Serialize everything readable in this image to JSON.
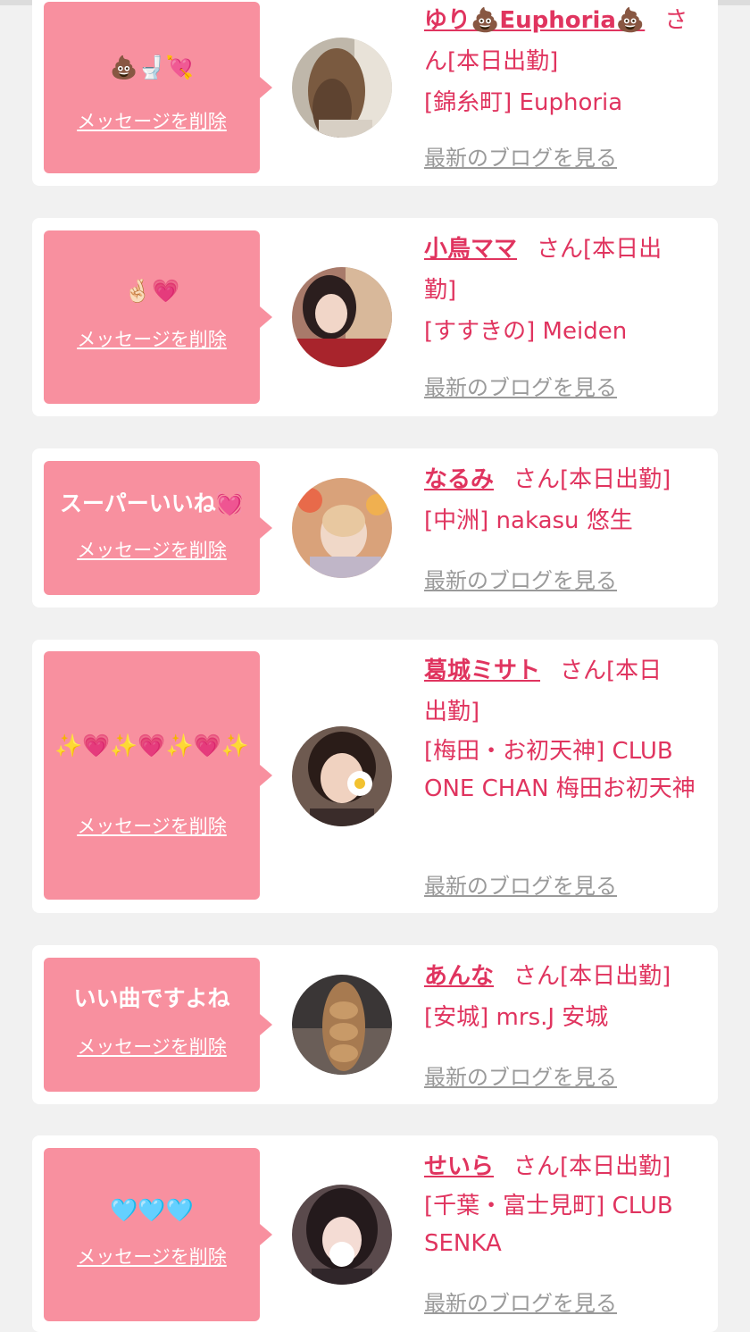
{
  "entries": [
    {
      "message": "💩🚽💘",
      "delete_label": "メッセージを削除",
      "name": "ゆり💩Euphoria💩",
      "san": "さ",
      "line2": "ん[本日出勤]",
      "line3": "[錦糸町] Euphoria",
      "blog_label": "最新のブログを見る"
    },
    {
      "message": "🤞🏻💗",
      "delete_label": "メッセージを削除",
      "name": "小鳥ママ",
      "san": "さん[本日出",
      "line2": "勤]",
      "line3": "[すすきの] Meiden",
      "blog_label": "最新のブログを見る"
    },
    {
      "message": "スーパーいいね💓",
      "delete_label": "メッセージを削除",
      "name": "なるみ",
      "san": "さん[本日出勤]",
      "line2": "[中洲] nakasu 悠生",
      "blog_label": "最新のブログを見る"
    },
    {
      "message": "✨💗✨💗✨💗✨",
      "delete_label": "メッセージを削除",
      "name": "葛城ミサト",
      "san": "さん[本日",
      "line2": "出勤]",
      "line3": "[梅田・お初天神] CLUB ONE CHAN 梅田お初天神",
      "blog_label": "最新のブログを見る"
    },
    {
      "message": "いい曲ですよね",
      "delete_label": "メッセージを削除",
      "name": "あんな",
      "san": "さん[本日出勤]",
      "line2": "[安城] mrs.J 安城",
      "blog_label": "最新のブログを見る"
    },
    {
      "message": "🩵🩵🩵",
      "delete_label": "メッセージを削除",
      "name": "せいら",
      "san": "さん[本日出勤]",
      "line2": "[千葉・富士見町] CLUB SENKA",
      "blog_label": "最新のブログを見る"
    }
  ]
}
